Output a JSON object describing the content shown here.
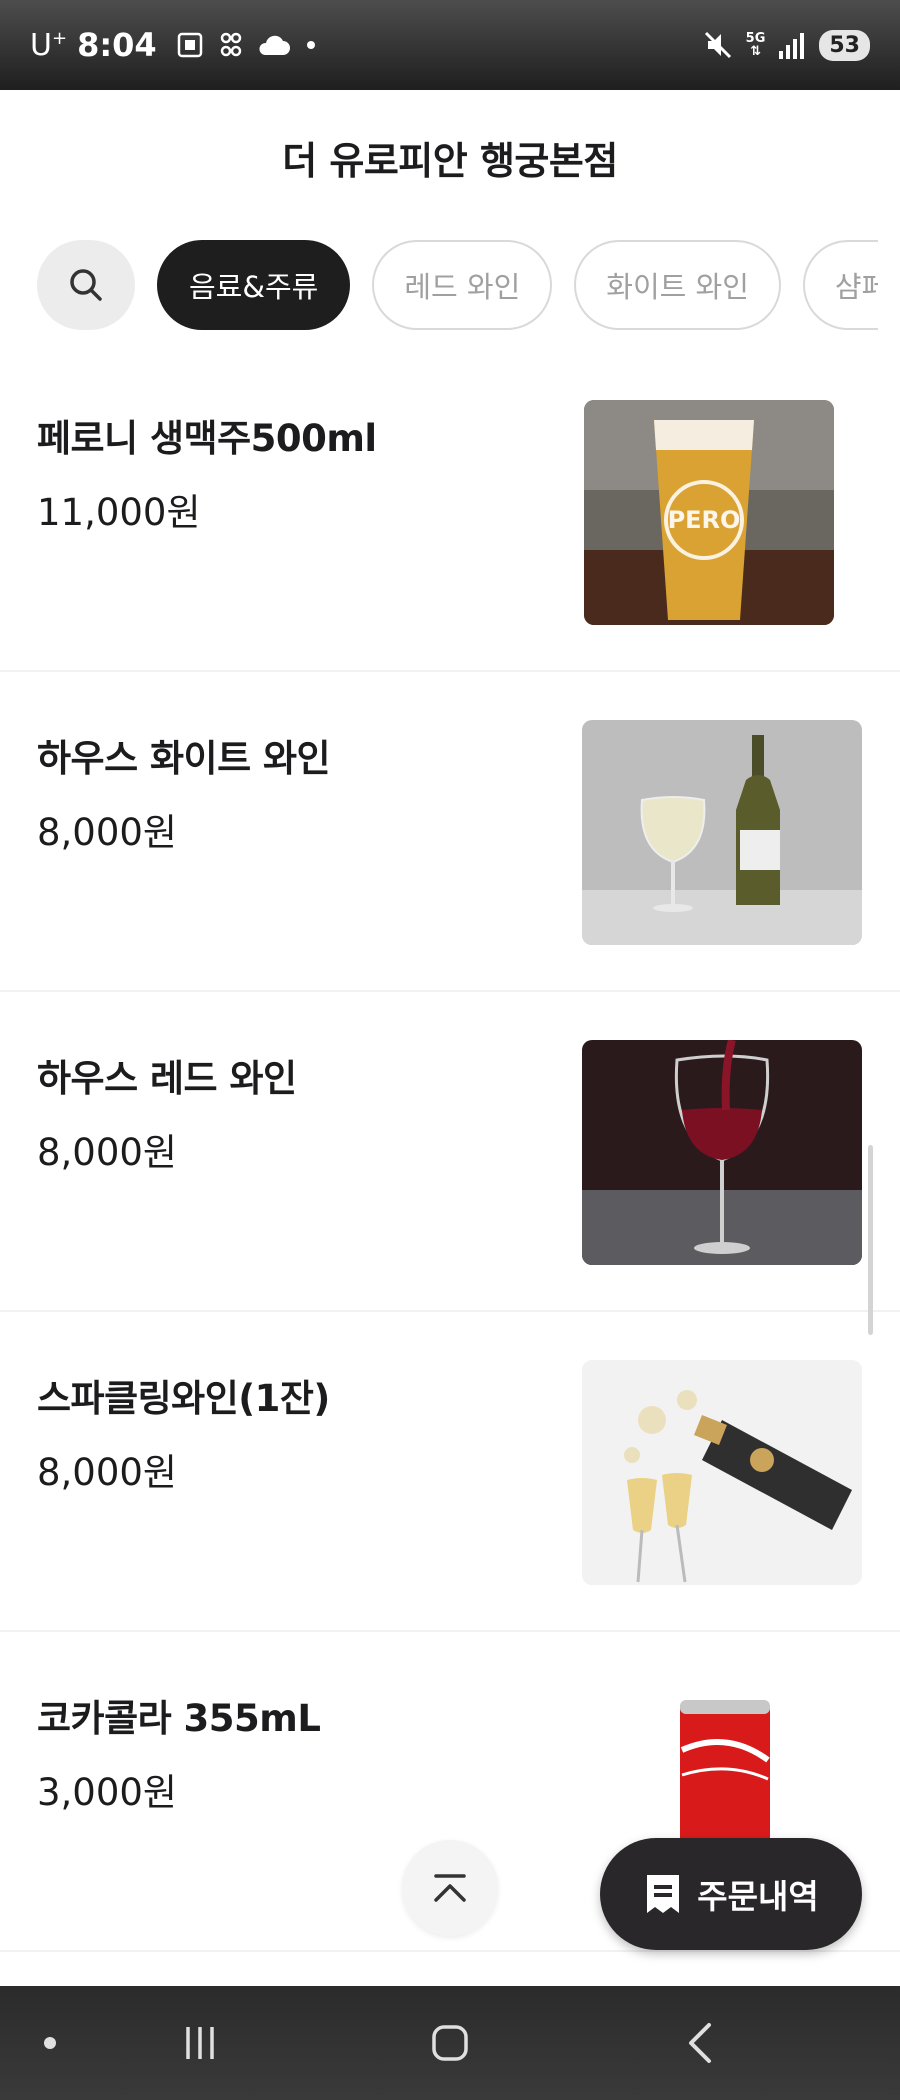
{
  "status_bar": {
    "carrier": "U",
    "carrier_sup": "+",
    "time": "8:04",
    "network": "5G",
    "battery": "53"
  },
  "header": {
    "title": "더 유로피안 행궁본점"
  },
  "tabs": [
    {
      "label": "음료&주류",
      "active": true
    },
    {
      "label": "레드 와인",
      "active": false
    },
    {
      "label": "화이트 와인",
      "active": false
    },
    {
      "label": "샴페인",
      "active": false
    }
  ],
  "menu_items": [
    {
      "name": "페로니 생맥주500ml",
      "price": "11,000원",
      "image_icon": "beer-glass-icon"
    },
    {
      "name": "하우스 화이트 와인",
      "price": "8,000원",
      "image_icon": "white-wine-icon"
    },
    {
      "name": "하우스 레드 와인",
      "price": "8,000원",
      "image_icon": "red-wine-icon"
    },
    {
      "name": "스파클링와인(1잔)",
      "price": "8,000원",
      "image_icon": "sparkling-wine-icon"
    },
    {
      "name": "코카콜라 355mL",
      "price": "3,000원",
      "image_icon": "cola-can-icon"
    }
  ],
  "order_button": {
    "label": "주문내역"
  },
  "colors": {
    "active_tab": "#1e1e1e",
    "order_button": "#2a272b",
    "text": "#1c1c1e",
    "muted": "#a0a0a0"
  }
}
